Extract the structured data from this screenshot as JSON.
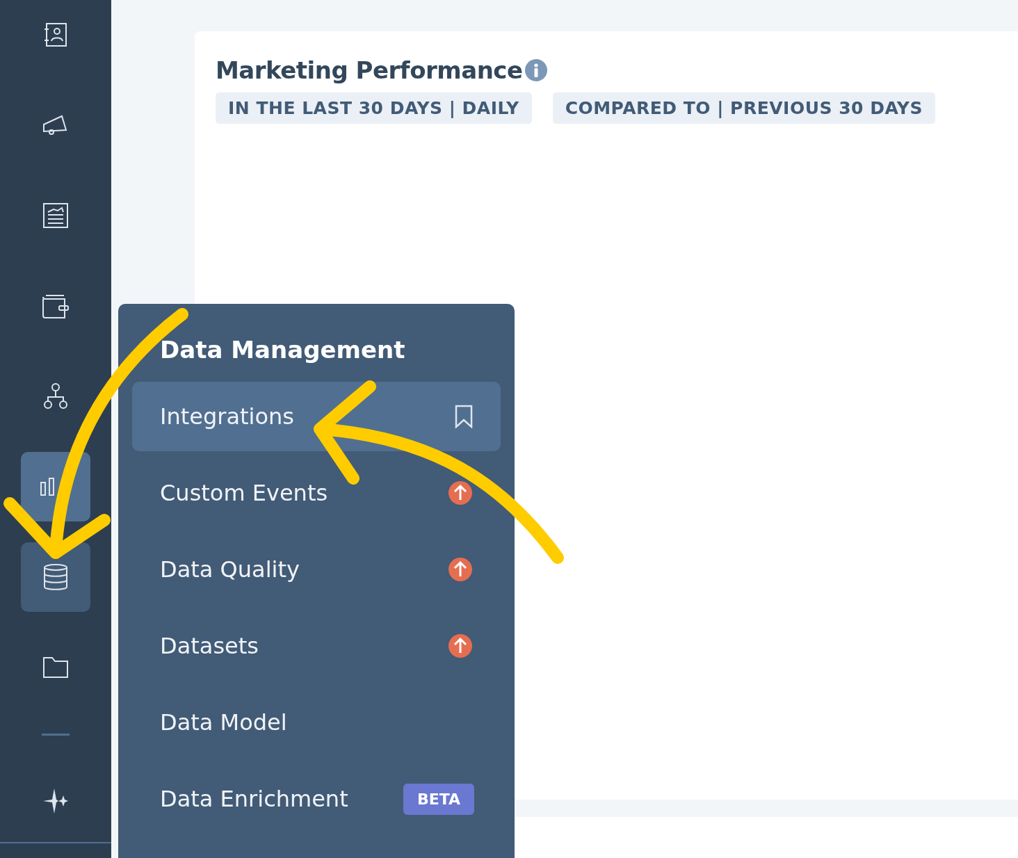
{
  "sidebar": {
    "items": [
      {
        "kind": "contacts",
        "selected": false,
        "open": false
      },
      {
        "kind": "megaphone",
        "selected": false,
        "open": false
      },
      {
        "kind": "report",
        "selected": false,
        "open": false
      },
      {
        "kind": "wallet",
        "selected": false,
        "open": false
      },
      {
        "kind": "hierarchy",
        "selected": false,
        "open": false
      },
      {
        "kind": "chart",
        "selected": true,
        "open": false
      },
      {
        "kind": "database",
        "selected": false,
        "open": true
      },
      {
        "kind": "folder",
        "selected": false,
        "open": false
      },
      {
        "kind": "sparkle",
        "selected": false,
        "open": false
      }
    ]
  },
  "card": {
    "title": "Marketing Performance",
    "chips": [
      "IN THE LAST 30 DAYS | DAILY",
      "COMPARED TO | PREVIOUS 30 DAYS"
    ]
  },
  "menu": {
    "title": "Data Management",
    "items": [
      {
        "label": "Integrations",
        "selected": true,
        "badge": {
          "kind": "bookmark"
        }
      },
      {
        "label": "Custom Events",
        "selected": false,
        "badge": {
          "kind": "upgrade"
        }
      },
      {
        "label": "Data Quality",
        "selected": false,
        "badge": {
          "kind": "upgrade"
        }
      },
      {
        "label": "Datasets",
        "selected": false,
        "badge": {
          "kind": "upgrade"
        }
      },
      {
        "label": "Data Model",
        "selected": false
      },
      {
        "label": "Data Enrichment",
        "selected": false,
        "badge": {
          "kind": "tag",
          "text": "BETA"
        }
      }
    ]
  }
}
